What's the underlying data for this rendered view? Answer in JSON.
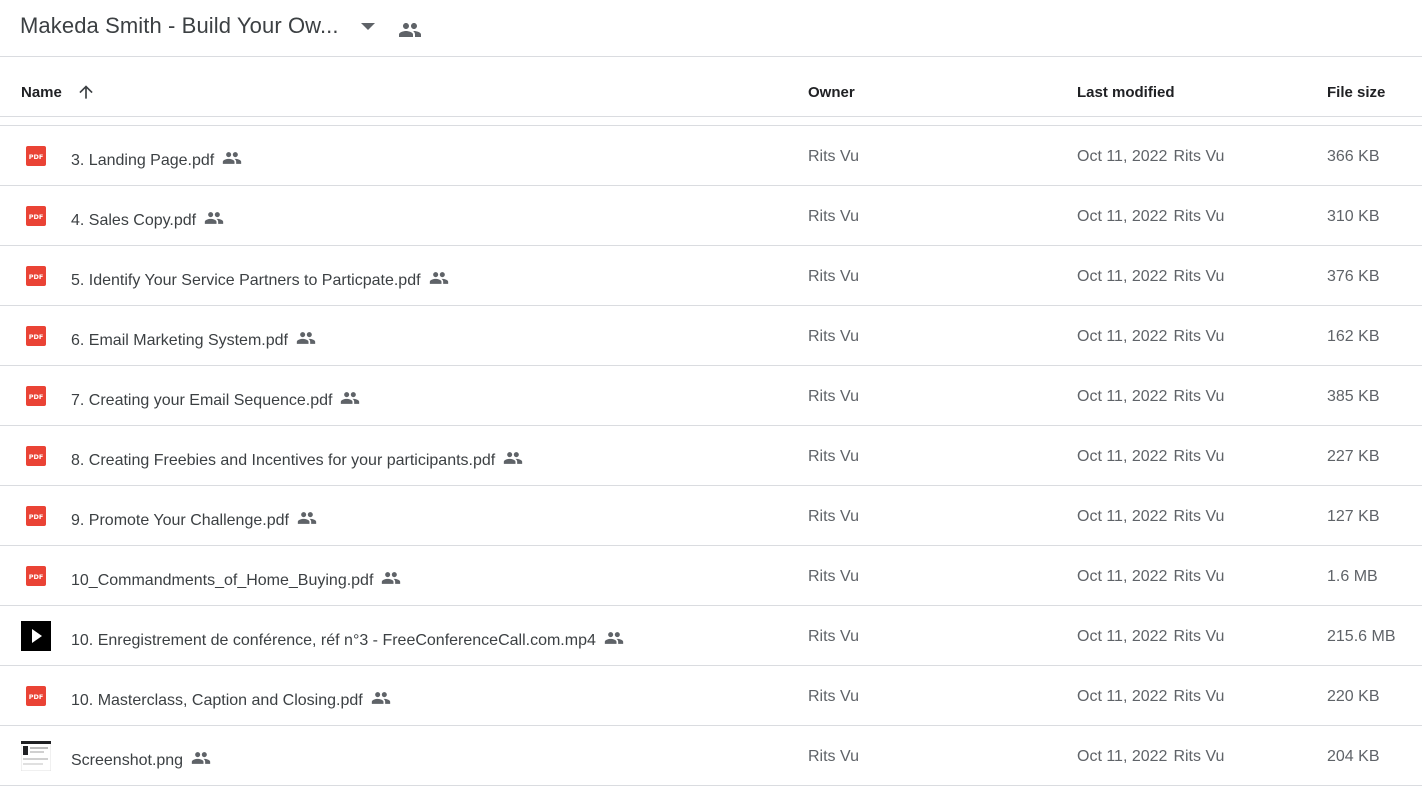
{
  "folder": {
    "title": "Makeda Smith - Build Your Ow..."
  },
  "colors": {
    "pdf": "#ea4335",
    "icon": "#5f6368",
    "divider": "#dadce0"
  },
  "columns": {
    "name": "Name",
    "owner": "Owner",
    "last_modified": "Last modified",
    "file_size": "File size",
    "sort": "ascending"
  },
  "files": [
    {
      "type": "pdf",
      "name": "3. Landing Page.pdf",
      "owner": "Rits Vu",
      "modified_date": "Oct 11, 2022",
      "modified_by": "Rits Vu",
      "size": "366 KB"
    },
    {
      "type": "pdf",
      "name": "4. Sales Copy.pdf",
      "owner": "Rits Vu",
      "modified_date": "Oct 11, 2022",
      "modified_by": "Rits Vu",
      "size": "310 KB"
    },
    {
      "type": "pdf",
      "name": "5. Identify Your Service Partners to Particpate.pdf",
      "owner": "Rits Vu",
      "modified_date": "Oct 11, 2022",
      "modified_by": "Rits Vu",
      "size": "376 KB"
    },
    {
      "type": "pdf",
      "name": "6. Email Marketing System.pdf",
      "owner": "Rits Vu",
      "modified_date": "Oct 11, 2022",
      "modified_by": "Rits Vu",
      "size": "162 KB"
    },
    {
      "type": "pdf",
      "name": "7. Creating your Email Sequence.pdf",
      "owner": "Rits Vu",
      "modified_date": "Oct 11, 2022",
      "modified_by": "Rits Vu",
      "size": "385 KB"
    },
    {
      "type": "pdf",
      "name": "8. Creating Freebies and Incentives for your participants.pdf",
      "owner": "Rits Vu",
      "modified_date": "Oct 11, 2022",
      "modified_by": "Rits Vu",
      "size": "227 KB"
    },
    {
      "type": "pdf",
      "name": "9. Promote Your Challenge.pdf",
      "owner": "Rits Vu",
      "modified_date": "Oct 11, 2022",
      "modified_by": "Rits Vu",
      "size": "127 KB"
    },
    {
      "type": "pdf",
      "name": "10_Commandments_of_Home_Buying.pdf",
      "owner": "Rits Vu",
      "modified_date": "Oct 11, 2022",
      "modified_by": "Rits Vu",
      "size": "1.6 MB"
    },
    {
      "type": "video",
      "name": "10. Enregistrement de conférence, réf n°3 - FreeConferenceCall.com.mp4",
      "owner": "Rits Vu",
      "modified_date": "Oct 11, 2022",
      "modified_by": "Rits Vu",
      "size": "215.6 MB"
    },
    {
      "type": "pdf",
      "name": "10. Masterclass, Caption and Closing.pdf",
      "owner": "Rits Vu",
      "modified_date": "Oct 11, 2022",
      "modified_by": "Rits Vu",
      "size": "220 KB"
    },
    {
      "type": "image",
      "name": "Screenshot.png",
      "owner": "Rits Vu",
      "modified_date": "Oct 11, 2022",
      "modified_by": "Rits Vu",
      "size": "204 KB"
    }
  ]
}
